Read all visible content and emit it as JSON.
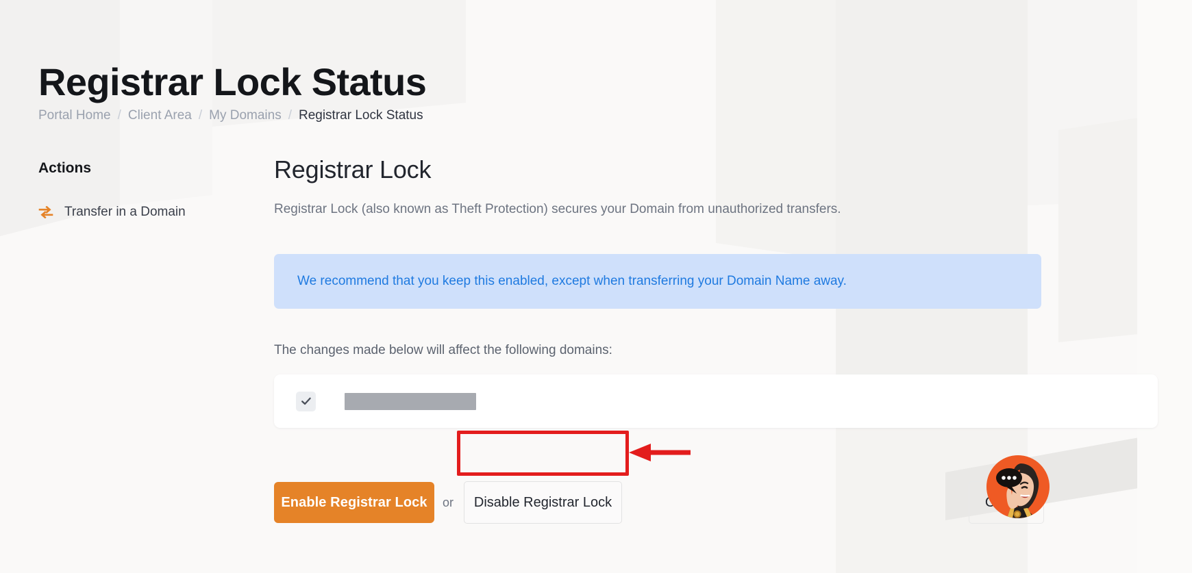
{
  "header": {
    "title": "Registrar Lock Status",
    "breadcrumb": [
      {
        "label": "Portal Home",
        "active": false
      },
      {
        "label": "Client Area",
        "active": false
      },
      {
        "label": "My Domains",
        "active": false
      },
      {
        "label": "Registrar Lock Status",
        "active": true
      }
    ],
    "breadcrumb_separator": "/"
  },
  "sidebar": {
    "heading": "Actions",
    "items": [
      {
        "label": "Transfer in a Domain",
        "icon": "transfer-arrows-icon"
      }
    ]
  },
  "main": {
    "section_title": "Registrar Lock",
    "section_description": "Registrar Lock (also known as Theft Protection) secures your Domain from unauthorized transfers.",
    "alert": {
      "type": "info",
      "text": "We recommend that you keep this enabled, except when transferring your Domain Name away.",
      "background_color": "#cfe0fb",
      "text_color": "#1f7ae0"
    },
    "domains_label": "The changes made below will affect the following domains:",
    "domains": [
      {
        "checked": true,
        "name": "",
        "redacted": true
      }
    ]
  },
  "actions": {
    "enable_label": "Enable Registrar Lock",
    "or_label": "or",
    "disable_label": "Disable Registrar Lock",
    "cancel_label": "Cancel",
    "primary_color": "#e58328"
  },
  "annotation": {
    "color": "#e31d1d",
    "target": "Disable Registrar Lock",
    "arrow_direction": "left"
  },
  "chat_widget": {
    "label": "Live chat",
    "background_color": "#ef5a24",
    "bubble_dots": 3
  }
}
